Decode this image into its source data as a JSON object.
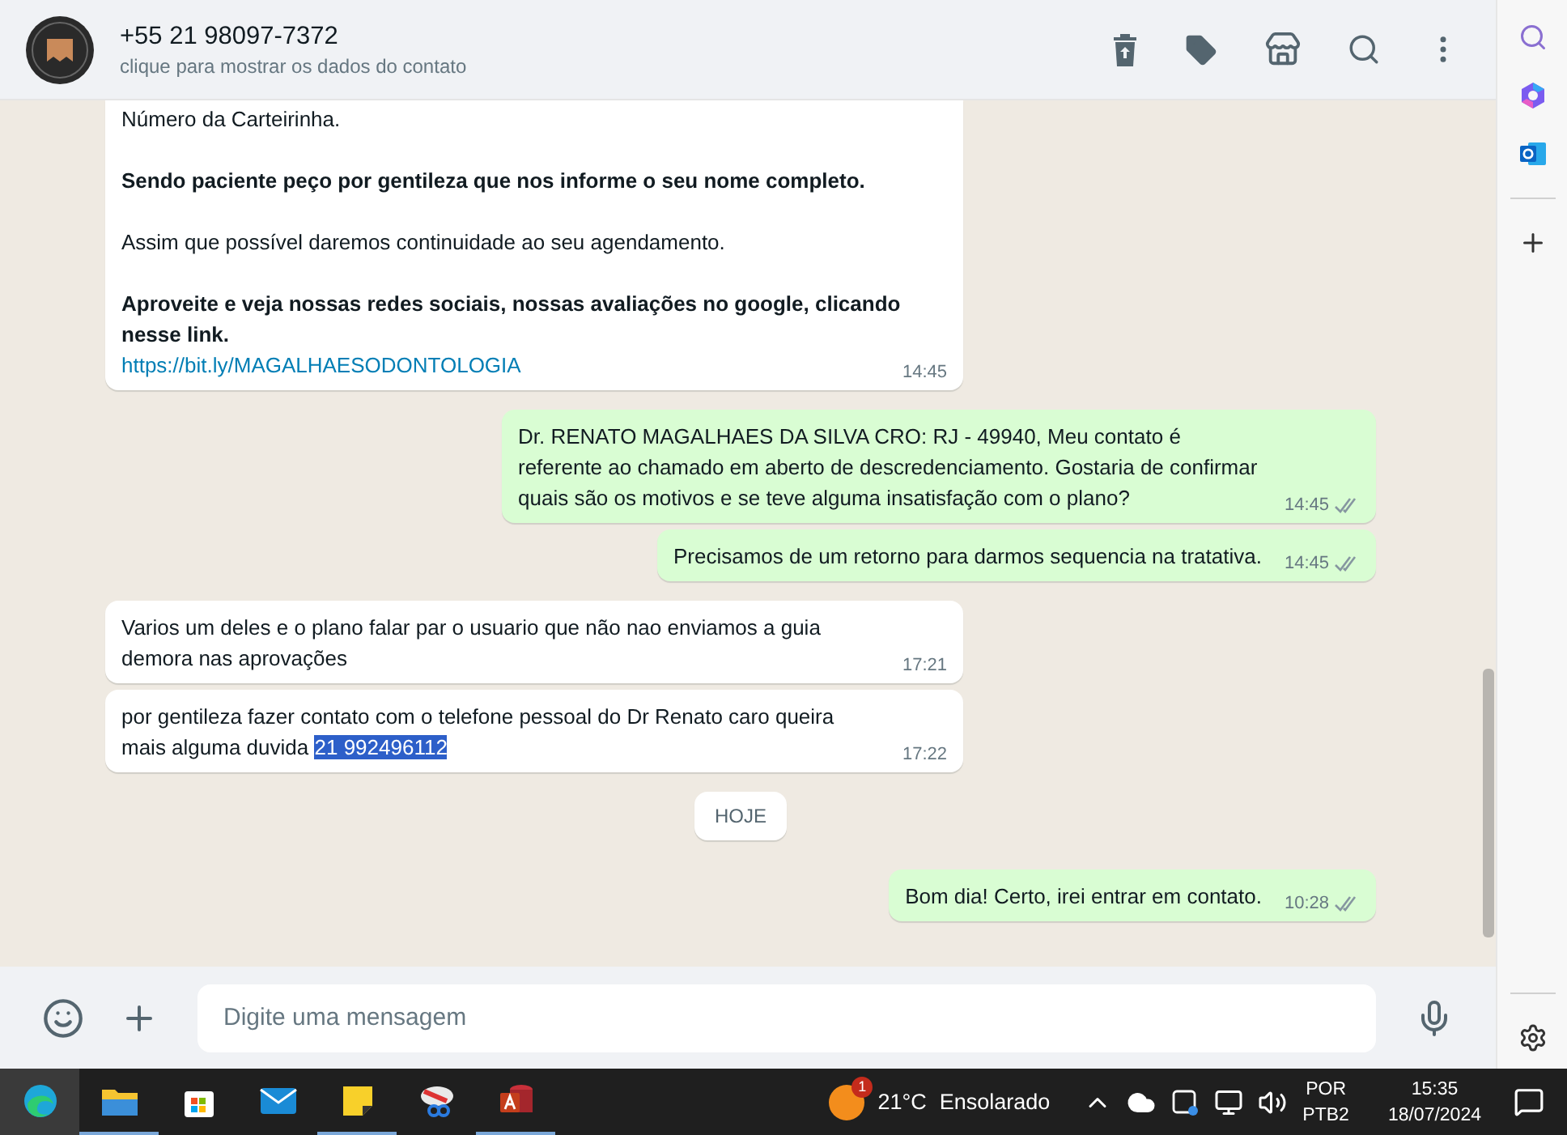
{
  "header": {
    "title": "+55 21 98097-7372",
    "subtitle": "clique para mostrar os dados do contato"
  },
  "messages": [
    {
      "kind": "incoming",
      "paragraphs": [
        {
          "text": "Número da Carteirinha.",
          "bold": false
        },
        {
          "text": "Sendo paciente peço por gentileza que nos informe o seu nome completo.",
          "bold": true
        },
        {
          "text": "Assim que possível daremos continuidade ao seu agendamento.",
          "bold": false
        },
        {
          "text": "Aproveite e veja nossas redes sociais, nossas avaliações no google, clicando nesse link.",
          "bold": true
        }
      ],
      "link": "https://bit.ly/MAGALHAESODONTOLOGIA",
      "time": "14:45"
    },
    {
      "kind": "outgoing",
      "paragraphs": [
        {
          "text": "Dr. RENATO MAGALHAES DA SILVA CRO: RJ - 49940, Meu contato é referente ao chamado em aberto de descredenciamento. Gostaria de confirmar quais são os motivos e se teve alguma insatisfação com o plano?",
          "bold": false
        }
      ],
      "time": "14:45",
      "read": false
    },
    {
      "kind": "outgoing",
      "paragraphs": [
        {
          "text": "Precisamos de um retorno para darmos sequencia na tratativa.",
          "bold": false
        }
      ],
      "time": "14:45",
      "read": false
    },
    {
      "kind": "incoming",
      "paragraphs": [
        {
          "text": "Varios um deles e o plano falar par o usuario que não nao enviamos a guia demora nas aprovações",
          "bold": false
        }
      ],
      "time": "17:21"
    },
    {
      "kind": "incoming",
      "paragraphs": [
        {
          "text": "por gentileza fazer contato com o telefone pessoal do Dr Renato caro queira mais alguma duvida",
          "bold": false
        }
      ],
      "selected_text": "21 992496112",
      "time": "17:22"
    },
    {
      "kind": "date",
      "text": "HOJE"
    },
    {
      "kind": "outgoing",
      "paragraphs": [
        {
          "text": "Bom dia! Certo, irei entrar em contato.",
          "bold": false
        }
      ],
      "time": "10:28",
      "read": false
    }
  ],
  "composer": {
    "placeholder": "Digite uma mensagem"
  },
  "taskbar": {
    "weather": {
      "badge": "1",
      "temperature": "21°C",
      "condition": "Ensolarado"
    },
    "language": "POR",
    "layout": "PTB2",
    "time": "15:35",
    "date": "18/07/2024"
  }
}
